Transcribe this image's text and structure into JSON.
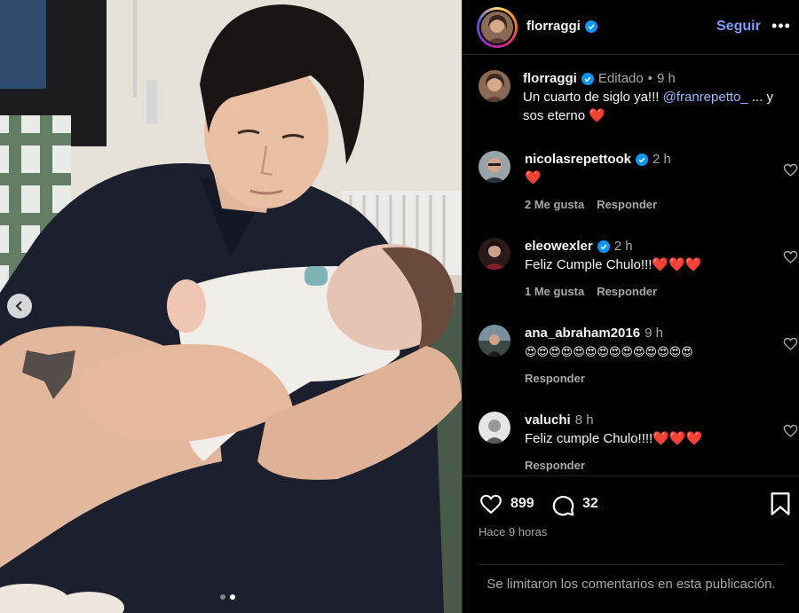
{
  "post": {
    "username": "florraggi",
    "follow_label": "Seguir",
    "more_label": "•••",
    "caption": {
      "username": "florraggi",
      "edited": "Editado",
      "sep": "•",
      "time": "9 h",
      "text_before": "Un cuarto de siglo ya!!! ",
      "mention": "@franrepetto_",
      "text_after": " ... y sos eterno ❤️"
    },
    "carousel": {
      "slides": 2,
      "current": 2
    }
  },
  "comments": [
    {
      "username": "nicolasrepettook",
      "verified": true,
      "time": "2 h",
      "text": "❤️",
      "likes_label": "2 Me gusta",
      "reply_label": "Responder"
    },
    {
      "username": "eleowexler",
      "verified": true,
      "time": "2 h",
      "text": "Feliz Cumple Chulo!!!❤️❤️❤️",
      "likes_label": "1 Me gusta",
      "reply_label": "Responder"
    },
    {
      "username": "ana_abraham2016",
      "verified": false,
      "time": "9 h",
      "text": "😍😍😍😍😍😍😍😍😍😍😍😍😍😍",
      "likes_label": "",
      "reply_label": "Responder"
    },
    {
      "username": "valuchi",
      "verified": false,
      "time": "8 h",
      "text": "Feliz cumple Chulo!!!!❤️❤️❤️",
      "likes_label": "",
      "reply_label": "Responder"
    }
  ],
  "footer": {
    "likes": "899",
    "comments": "32",
    "ago": "Hace 9 horas",
    "limited": "Se limitaron los comentarios en esta publicación."
  },
  "colors": {
    "accent": "#0095f6",
    "follow": "#7e9bff",
    "mention": "#9eb6ff",
    "heart": "#ff3040"
  },
  "icons": [
    "verified-badge-icon",
    "heart-icon",
    "comment-icon",
    "bookmark-icon",
    "chevron-left-icon",
    "more-icon"
  ]
}
